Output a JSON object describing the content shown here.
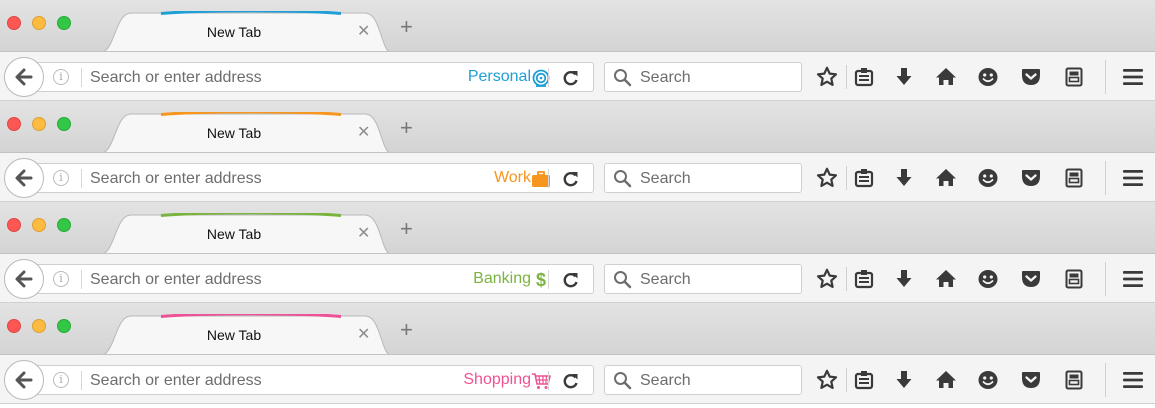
{
  "windows": [
    {
      "tab_title": "New Tab",
      "container_label": "Personal",
      "container_icon": "fingerprint-icon",
      "color": "#1f9fd6"
    },
    {
      "tab_title": "New Tab",
      "container_label": "Work",
      "container_icon": "briefcase-icon",
      "color": "#f7961e"
    },
    {
      "tab_title": "New Tab",
      "container_label": "Banking",
      "container_icon": "dollar-icon",
      "color": "#7bb340"
    },
    {
      "tab_title": "New Tab",
      "container_label": "Shopping",
      "container_icon": "cart-icon",
      "color": "#ee5195"
    }
  ],
  "tab_close_glyph": "✕",
  "new_tab_glyph": "+",
  "url_placeholder": "Search or enter address",
  "search_placeholder": "Search",
  "toolbar_icons": [
    "star-icon",
    "library-icon",
    "download-icon",
    "home-icon",
    "emoji-icon",
    "pocket-icon",
    "sidebar-icon",
    "hamburger-menu-icon"
  ]
}
